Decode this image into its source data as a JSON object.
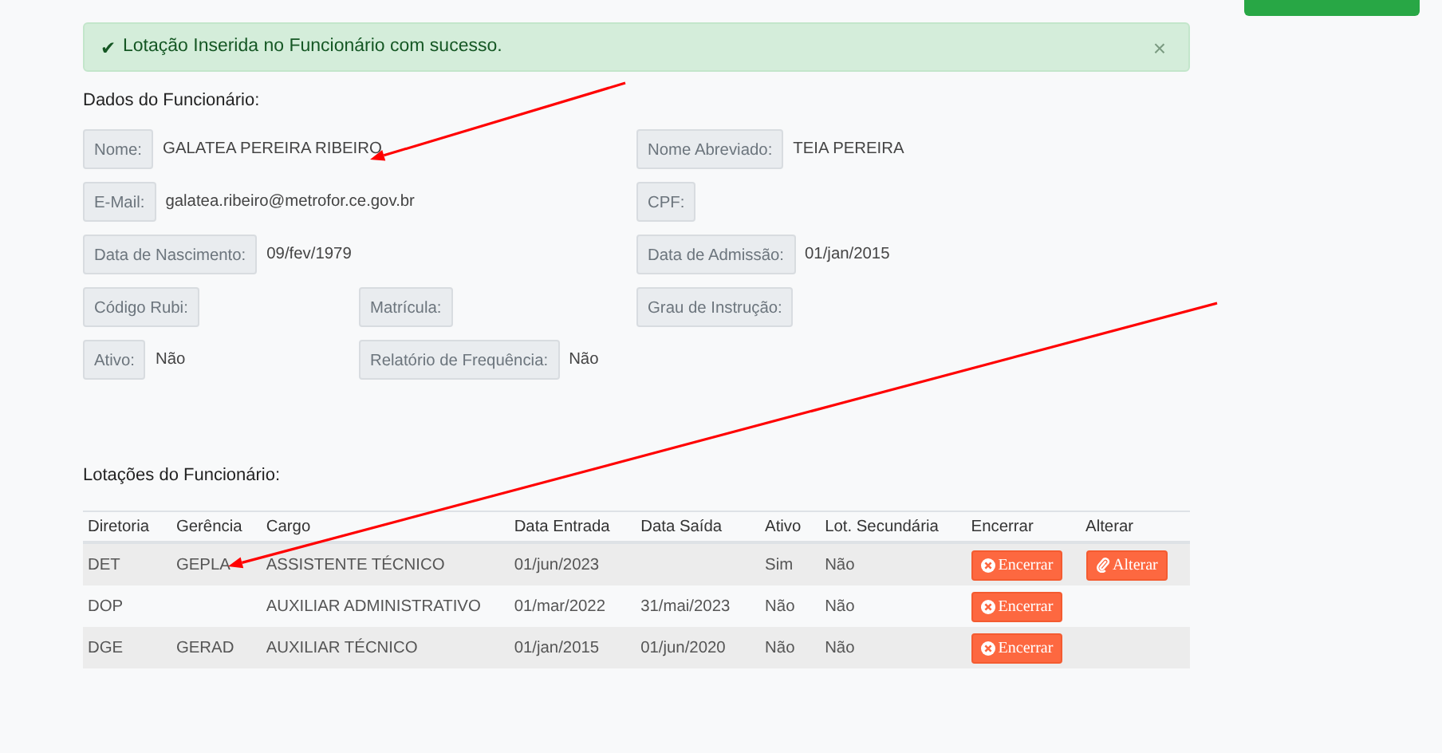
{
  "alert": {
    "icon_text": "✔",
    "message": "Lotação Inserida no Funcionário com sucesso.",
    "close": "×"
  },
  "employee": {
    "title": "Dados do Funcionário:",
    "rows": [
      [
        {
          "label": "Nome:",
          "value": "GALATEA PEREIRA RIBEIRO"
        },
        null,
        {
          "label": "Nome Abreviado:",
          "value": "TEIA PEREIRA"
        }
      ],
      [
        {
          "label": "E-Mail:",
          "value": "galatea.ribeiro@metrofor.ce.gov.br"
        },
        null,
        {
          "label": "CPF:"
        }
      ],
      [
        {
          "label": "Data de Nascimento:",
          "value": "09/fev/1979"
        },
        null,
        {
          "label": "Data de Admissão:",
          "value": "01/jan/2015"
        }
      ],
      [
        {
          "label": "Código Rubi:"
        },
        {
          "label": "Matrícula:"
        },
        {
          "label": "Grau de Instrução:"
        }
      ],
      [
        {
          "label": "Ativo:",
          "value": "Não"
        },
        {
          "label": "Relatório de Frequência:",
          "value": "Não"
        },
        null
      ]
    ]
  },
  "lotacoes": {
    "title": "Lotações do Funcionário:",
    "columns": [
      "Diretoria",
      "Gerência",
      "Cargo",
      "Data Entrada",
      "Data Saída",
      "Ativo",
      "Lot. Secundária",
      "Encerrar",
      "Alterar"
    ],
    "rows": [
      {
        "cells": [
          "DET",
          "GEPLA",
          "ASSISTENTE TÉCNICO",
          "01/jun/2023",
          "",
          "Sim",
          "Não"
        ],
        "encerrar": "Encerrar",
        "alterar": "Alterar"
      },
      {
        "cells": [
          "DOP",
          "",
          "AUXILIAR ADMINISTRATIVO",
          "01/mar/2022",
          "31/mai/2023",
          "Não",
          "Não"
        ],
        "encerrar": "Encerrar"
      },
      {
        "cells": [
          "DGE",
          "GERAD",
          "AUXILIAR TÉCNICO",
          "01/jan/2015",
          "01/jun/2020",
          "Não",
          "Não"
        ],
        "encerrar": "Encerrar"
      }
    ]
  },
  "annotations": [
    {
      "kind": "arrow"
    },
    {
      "kind": "arrow"
    }
  ]
}
